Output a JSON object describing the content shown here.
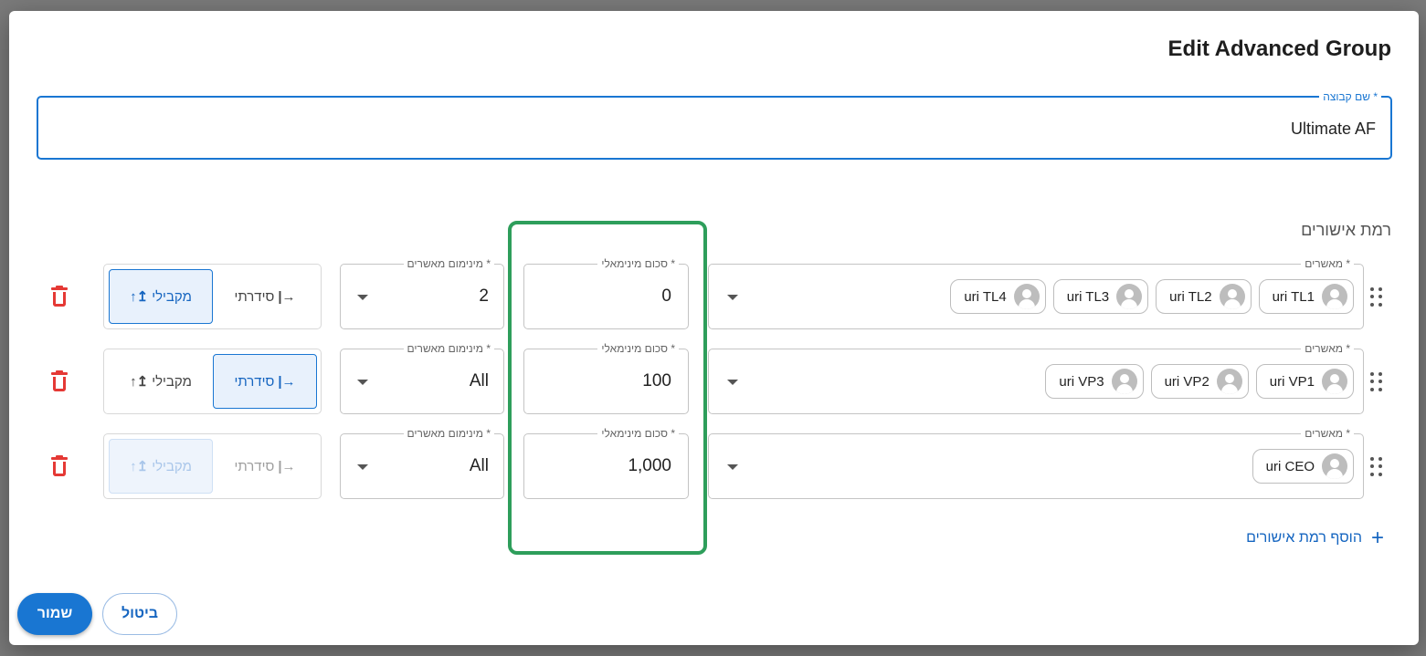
{
  "dialog": {
    "title": "Edit Advanced Group",
    "group_name_label": "שם קבוצה *",
    "group_name_value": "Ultimate AF",
    "section_label": "רמת אישורים"
  },
  "rows": [
    {
      "approvers_label": "מאשרים *",
      "approvers": [
        "uri TL1",
        "uri TL2",
        "uri TL3",
        "uri TL4"
      ],
      "min_amount_label": "סכום מינימאלי *",
      "min_amount": "0",
      "min_approvers_label": "מינימום מאשרים *",
      "min_approvers": "2",
      "serial_label": "סידרתי",
      "parallel_label": "מקבילי",
      "selected_mode": "parallel"
    },
    {
      "approvers_label": "מאשרים *",
      "approvers": [
        "uri VP1",
        "uri VP2",
        "uri VP3"
      ],
      "min_amount_label": "סכום מינימאלי *",
      "min_amount": "100",
      "min_approvers_label": "מינימום מאשרים *",
      "min_approvers": "All",
      "serial_label": "סידרתי",
      "parallel_label": "מקבילי",
      "selected_mode": "serial"
    },
    {
      "approvers_label": "מאשרים *",
      "approvers": [
        "uri CEO"
      ],
      "min_amount_label": "סכום מינימאלי *",
      "min_amount": "1,000",
      "min_approvers_label": "מינימום מאשרים *",
      "min_approvers": "All",
      "serial_label": "סידרתי",
      "parallel_label": "מקבילי",
      "selected_mode": "parallel-disabled"
    }
  ],
  "add_level_label": "הוסף רמת אישורים",
  "buttons": {
    "save": "שמור",
    "cancel": "ביטול"
  },
  "colors": {
    "primary": "#1976d2",
    "danger": "#e53935",
    "highlight": "#2e9e5b"
  },
  "icons": {
    "serial": "arrow-right-bar-icon",
    "parallel": "arrows-up-icon",
    "delete": "trash-icon",
    "drag": "drag-dots-icon",
    "add": "plus-icon",
    "avatar": "person-icon"
  }
}
